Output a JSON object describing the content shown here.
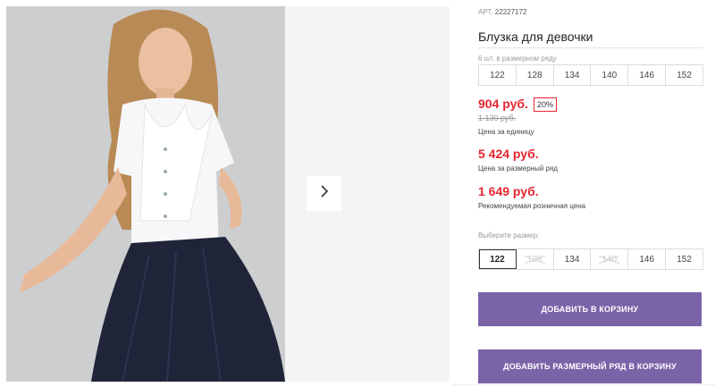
{
  "product": {
    "article_label": "АРТ.",
    "article_value": "22227172",
    "title": "Блузка для девочки",
    "range_label": "6 шт. в размерном ряду",
    "range_sizes": [
      "122",
      "128",
      "134",
      "140",
      "146",
      "152"
    ],
    "unit_price": "904 руб.",
    "discount": "20%",
    "old_price": "1 130 руб.",
    "unit_caption": "Цена за единицу",
    "range_price": "5 424 руб.",
    "range_caption": "Цена за размерный ряд",
    "rrp_price": "1 649 руб.",
    "rrp_caption": "Рекомендуемая розничная цена",
    "choose_label": "Выберите размер:",
    "pick_sizes": [
      {
        "label": "122",
        "state": "selected"
      },
      {
        "label": "128",
        "state": "disabled"
      },
      {
        "label": "134",
        "state": "available"
      },
      {
        "label": "140",
        "state": "disabled"
      },
      {
        "label": "146",
        "state": "available"
      },
      {
        "label": "152",
        "state": "available"
      }
    ]
  },
  "buttons": {
    "add_to_cart": "ДОБАВИТЬ В КОРЗИНУ",
    "add_range_to_cart": "ДОБАВИТЬ РАЗМЕРНЫЙ РЯД В КОРЗИНУ"
  },
  "gallery": {
    "next_icon": "chevron-right-icon"
  },
  "colors": {
    "accent": "#7b63a8",
    "price": "#e3262f"
  }
}
